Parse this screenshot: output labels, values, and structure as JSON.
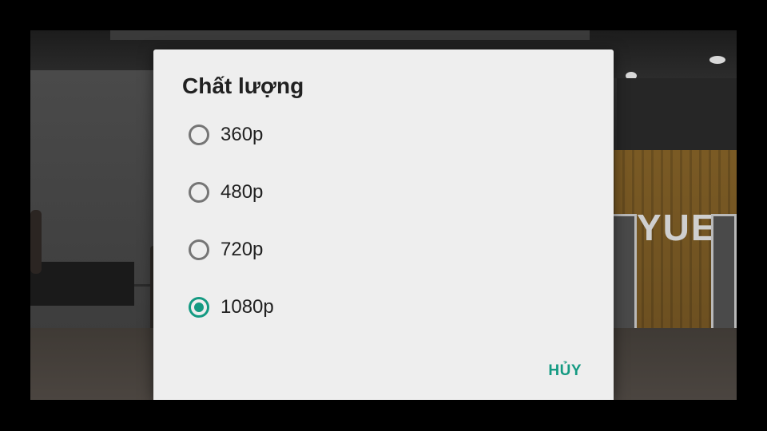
{
  "dialog": {
    "title": "Chất lượng",
    "options": [
      {
        "label": "360p",
        "selected": false
      },
      {
        "label": "480p",
        "selected": false
      },
      {
        "label": "720p",
        "selected": false
      },
      {
        "label": "1080p",
        "selected": true
      }
    ],
    "cancel_label": "HỦY",
    "accent_color": "#149a82"
  },
  "background": {
    "sign_text": "YUE"
  }
}
